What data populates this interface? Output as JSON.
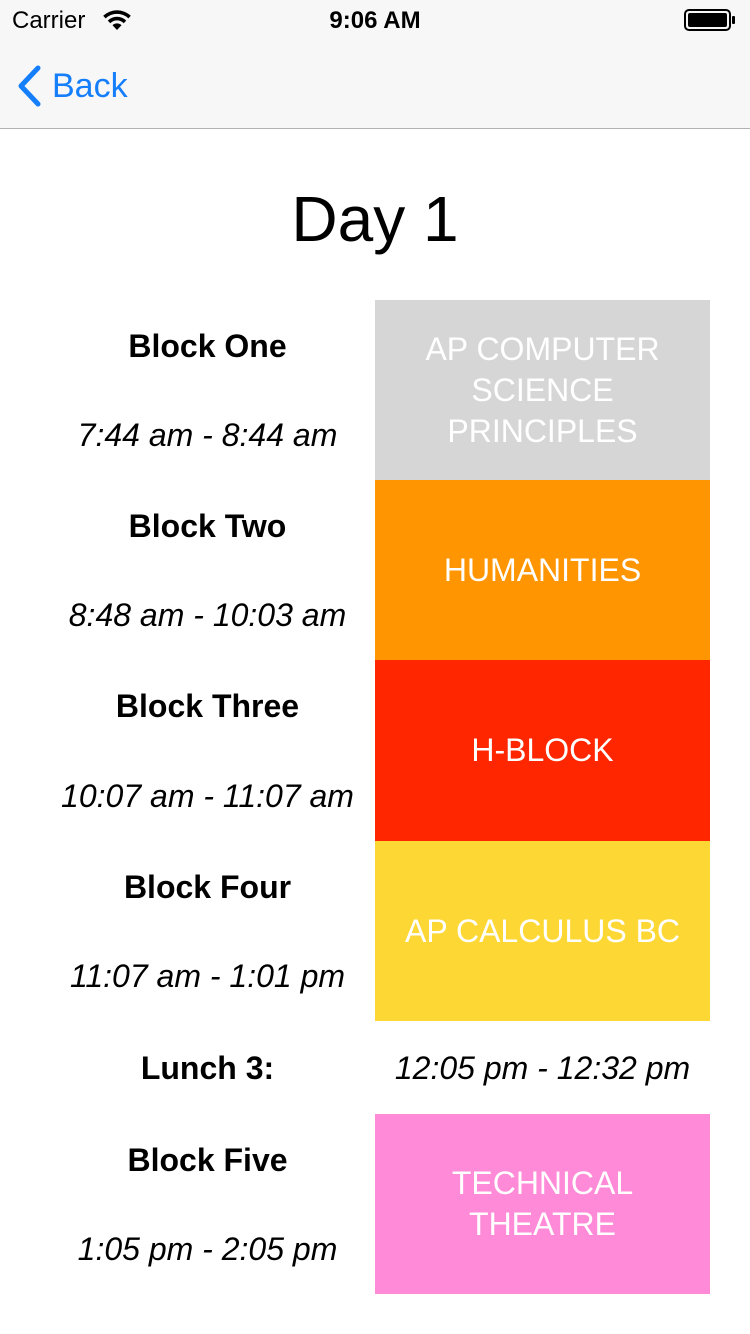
{
  "status_bar": {
    "carrier": "Carrier",
    "time": "9:06 AM",
    "wifi_icon": "wifi-icon",
    "battery_icon": "battery-icon"
  },
  "nav": {
    "back_label": "Back",
    "back_icon": "chevron-left-icon",
    "accent_color": "#147efb"
  },
  "title": "Day 1",
  "blocks": [
    {
      "label": "Block One",
      "time": "7:44 am - 8:44 am",
      "class_name": "AP COMPUTER SCIENCE PRINCIPLES",
      "color": "#d6d6d6"
    },
    {
      "label": "Block Two",
      "time": "8:48 am - 10:03 am",
      "class_name": "HUMANITIES",
      "color": "#ff9500"
    },
    {
      "label": "Block Three",
      "time": "10:07 am - 11:07 am",
      "class_name": "H-BLOCK",
      "color": "#ff2600"
    },
    {
      "label": "Block Four",
      "time": "11:07 am - 1:01 pm",
      "class_name": "AP CALCULUS BC",
      "color": "#fdd835"
    },
    {
      "label": "Block Five",
      "time": "1:05 pm - 2:05 pm",
      "class_name": "TECHNICAL THEATRE",
      "color": "#ff8ad8"
    }
  ],
  "lunch": {
    "label": "Lunch 3:",
    "time": "12:05 pm - 12:32 pm"
  }
}
